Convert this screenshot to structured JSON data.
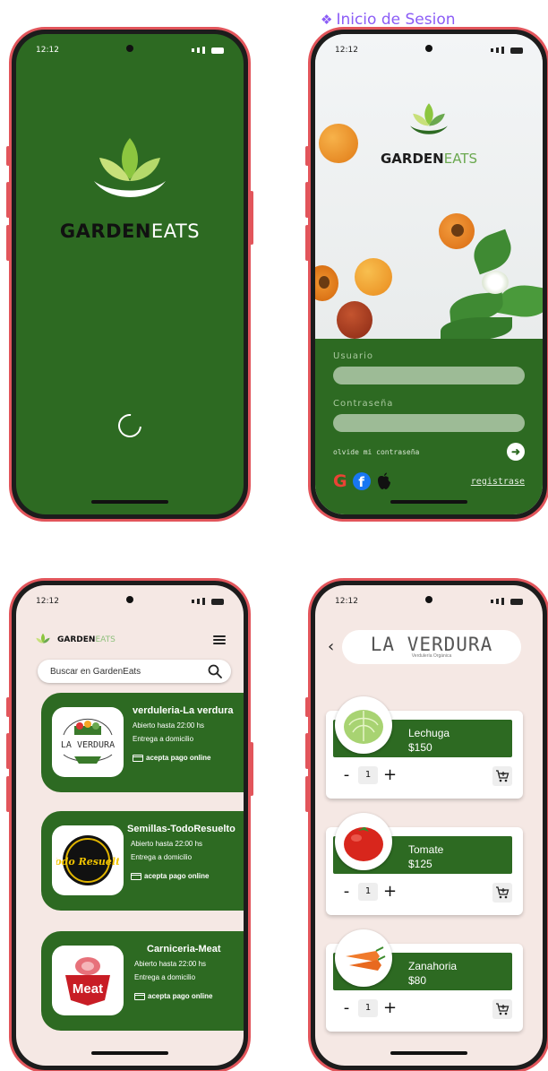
{
  "frame_label": "Inicio de Sesion",
  "brand": {
    "part1": "GARDEN",
    "part2": "EATS",
    "part2_small": "EATS"
  },
  "status_time": "12:12",
  "login": {
    "user_label": "Usuario",
    "password_label": "Contraseña",
    "forgot": "olvide mi contraseña",
    "submit_icon": "arrow-right-icon",
    "register": "registrase",
    "social": [
      "G",
      "f",
      "apple"
    ]
  },
  "stores": {
    "search_placeholder": "Buscar en GardenEats",
    "items": [
      {
        "name": "verduleria-La verdura",
        "hours": "Abierto hasta 22:00 hs",
        "delivery": "Entrega a domicilio",
        "payment": "acepta pago online",
        "logo_text": "LA VERDURA"
      },
      {
        "name": "Semillas-TodoResuelto",
        "hours": "Abierto hasta 22:00 hs",
        "delivery": "Entrega a domicilio",
        "payment": "acepta pago online",
        "logo_text": "Todo Resuelto"
      },
      {
        "name": "Carniceria-Meat",
        "hours": "Abierto hasta 22:00 hs",
        "delivery": "Entrega a domicilio",
        "payment": "acepta pago online",
        "logo_text": "Meat"
      }
    ]
  },
  "shop": {
    "title": "LA VERDURA",
    "subtitle": "Verdulería Orgánica",
    "products": [
      {
        "name": "Lechuga",
        "price": "$150",
        "qty": "1"
      },
      {
        "name": "Tomate",
        "price": "$125",
        "qty": "1"
      },
      {
        "name": "Zanahoria",
        "price": "$80",
        "qty": "1"
      }
    ],
    "minus": "-",
    "plus": "+"
  },
  "colors": {
    "green": "#2d6a22",
    "phone_border": "#e2555b",
    "label": "#8b5cf6",
    "blush": "#f5e8e4"
  }
}
